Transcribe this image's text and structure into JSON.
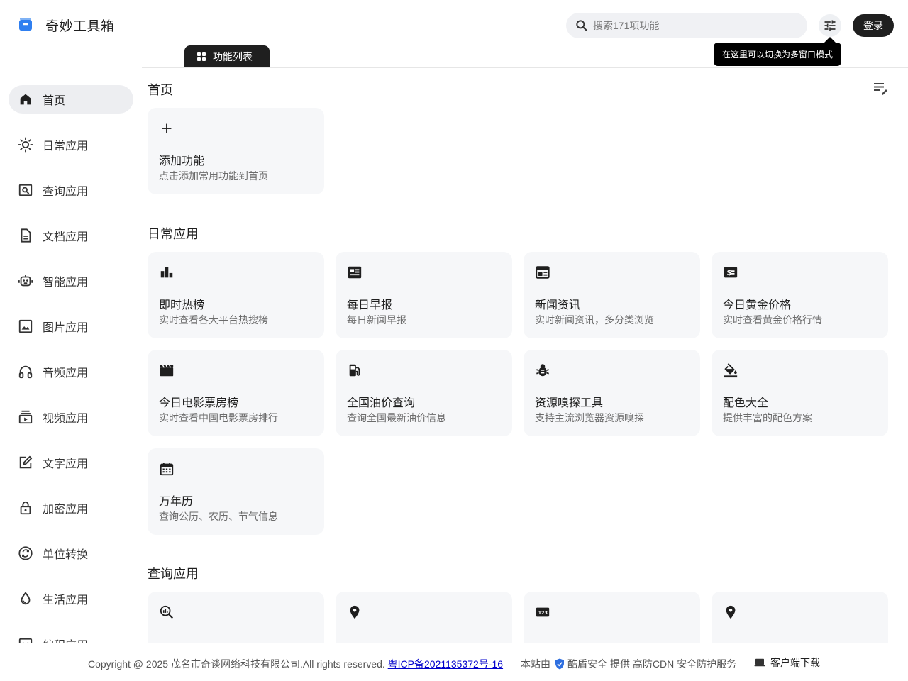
{
  "header": {
    "brand": "奇妙工具箱",
    "search_placeholder": "搜索171项功能",
    "login_label": "登录",
    "tooltip": "在这里可以切换为多窗口模式"
  },
  "tab": {
    "label": "功能列表"
  },
  "sidebar": {
    "items": [
      {
        "label": "首页",
        "icon": "home-icon",
        "active": true
      },
      {
        "label": "日常应用",
        "icon": "sun-icon"
      },
      {
        "label": "查询应用",
        "icon": "search-doc-icon"
      },
      {
        "label": "文档应用",
        "icon": "document-icon"
      },
      {
        "label": "智能应用",
        "icon": "robot-icon"
      },
      {
        "label": "图片应用",
        "icon": "image-icon"
      },
      {
        "label": "音频应用",
        "icon": "headphones-icon"
      },
      {
        "label": "视频应用",
        "icon": "video-icon"
      },
      {
        "label": "文字应用",
        "icon": "edit-icon"
      },
      {
        "label": "加密应用",
        "icon": "lock-icon"
      },
      {
        "label": "单位转换",
        "icon": "convert-icon"
      },
      {
        "label": "生活应用",
        "icon": "drop-icon"
      },
      {
        "label": "编程应用",
        "icon": "code-icon"
      }
    ]
  },
  "main": {
    "home": {
      "title": "首页",
      "add_card": {
        "title": "添加功能",
        "desc": "点击添加常用功能到首页"
      }
    },
    "daily": {
      "title": "日常应用",
      "cards": [
        {
          "title": "即时热榜",
          "desc": "实时查看各大平台热搜榜",
          "icon": "bar-chart-icon"
        },
        {
          "title": "每日早报",
          "desc": "每日新闻早报",
          "icon": "newspaper-icon"
        },
        {
          "title": "新闻资讯",
          "desc": "实时新闻资讯，多分类浏览",
          "icon": "news-icon"
        },
        {
          "title": "今日黄金价格",
          "desc": "实时查看黄金价格行情",
          "icon": "price-icon"
        },
        {
          "title": "今日电影票房榜",
          "desc": "实时查看中国电影票房排行",
          "icon": "clapperboard-icon"
        },
        {
          "title": "全国油价查询",
          "desc": "查询全国最新油价信息",
          "icon": "gas-station-icon"
        },
        {
          "title": "资源嗅探工具",
          "desc": "支持主流浏览器资源嗅探",
          "icon": "bug-icon"
        },
        {
          "title": "配色大全",
          "desc": "提供丰富的配色方案",
          "icon": "paint-bucket-icon"
        },
        {
          "title": "万年历",
          "desc": "查询公历、农历、节气信息",
          "icon": "calendar-icon"
        }
      ]
    },
    "query": {
      "title": "查询应用",
      "cards": [
        {
          "icon": "query-stats-icon"
        },
        {
          "icon": "location-pin-icon"
        },
        {
          "icon": "numbers-icon"
        },
        {
          "icon": "location-pin-icon"
        }
      ]
    }
  },
  "footer": {
    "copyright": "Copyright @ 2025 茂名市奇谈网络科技有限公司.All rights reserved.",
    "icp": "粤ICP备2021135372号-16",
    "provider_prefix": "本站由",
    "provider_name": "酷盾安全",
    "provider_suffix": "提供 高防CDN 安全防护服务",
    "download": "客户端下载"
  },
  "colors": {
    "accent": "#1f1f1f",
    "logo": "#3b82f6",
    "card_bg": "#f6f7f9",
    "active_nav": "#edeef1"
  }
}
